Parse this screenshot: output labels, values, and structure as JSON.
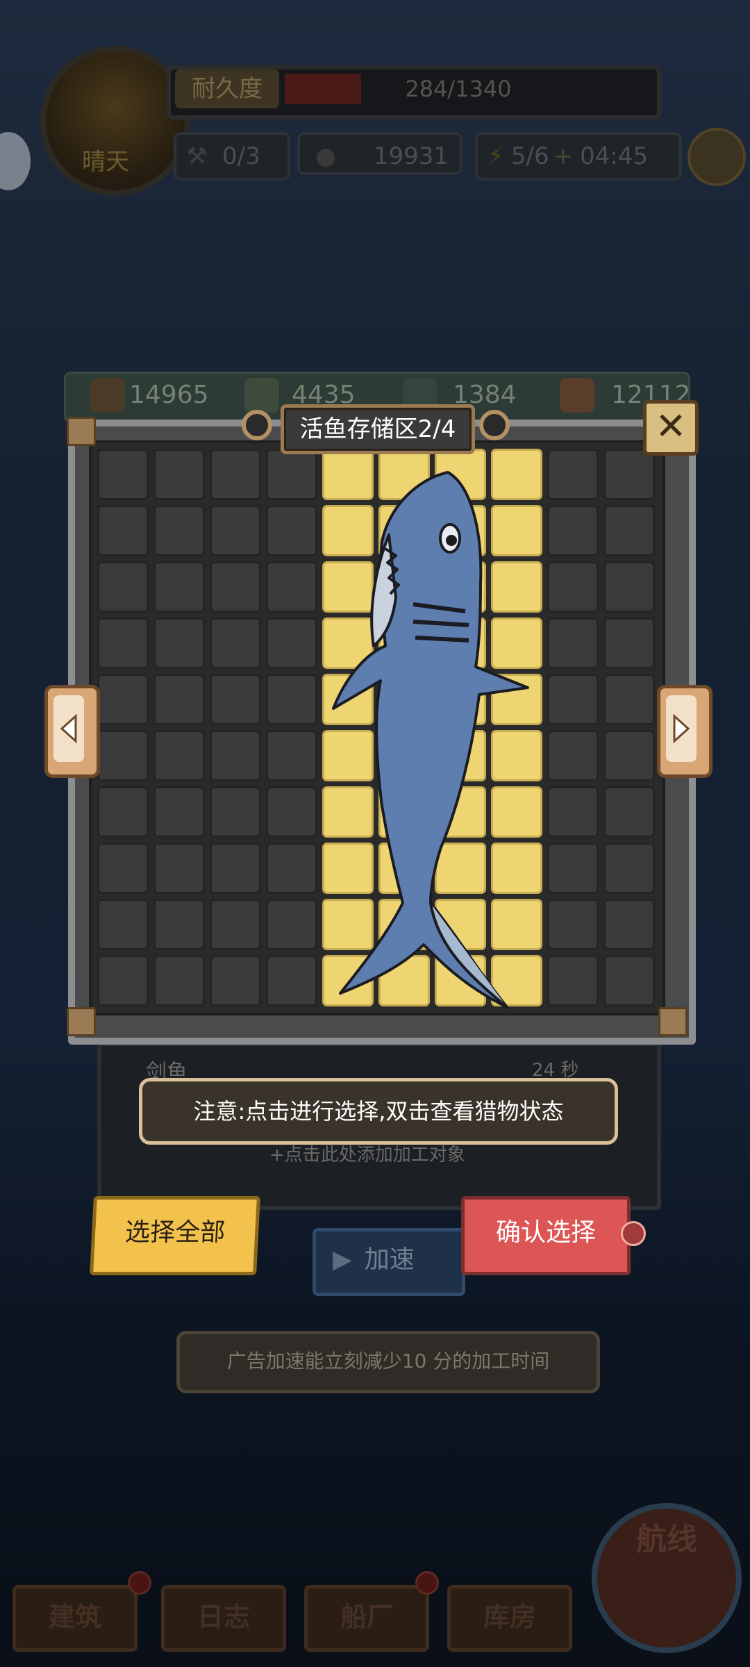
{
  "hud": {
    "weather": "晴天",
    "durability_label": "耐久度",
    "durability_value": "284/1340",
    "tools": "0/3",
    "coins": "19931",
    "energy": "5/6",
    "timer": "04:45"
  },
  "resources": [
    {
      "icon": "wood-icon",
      "value": "14965"
    },
    {
      "icon": "metal-icon",
      "value": "4435"
    },
    {
      "icon": "cloth-icon",
      "value": "1384"
    },
    {
      "icon": "meat-icon",
      "value": "12112"
    }
  ],
  "storage": {
    "title": "活鱼存储区2/4",
    "close_icon": "close-icon",
    "rows": 10,
    "cols": 10,
    "highlighted_cols": [
      4,
      5,
      6,
      7
    ],
    "fish_name": "shark"
  },
  "background_panel": {
    "item_name": "剑鱼",
    "item_time": "24 秒",
    "add_hint": "+点击此处添加加工对象"
  },
  "notice": "注意:点击进行选择,双击查看猎物状态",
  "buttons": {
    "select_all": "选择全部",
    "confirm": "确认选择",
    "speed_up": "加速"
  },
  "ad_tip": "广告加速能立刻减少10 分的加工时间",
  "nav": [
    "建筑",
    "日志",
    "船厂",
    "库房"
  ],
  "route": "航线",
  "colors": {
    "highlight_cell": "#efd571",
    "empty_cell": "#3b3b3c",
    "confirm_red": "#dc5656",
    "select_yellow": "#f2c24d"
  }
}
